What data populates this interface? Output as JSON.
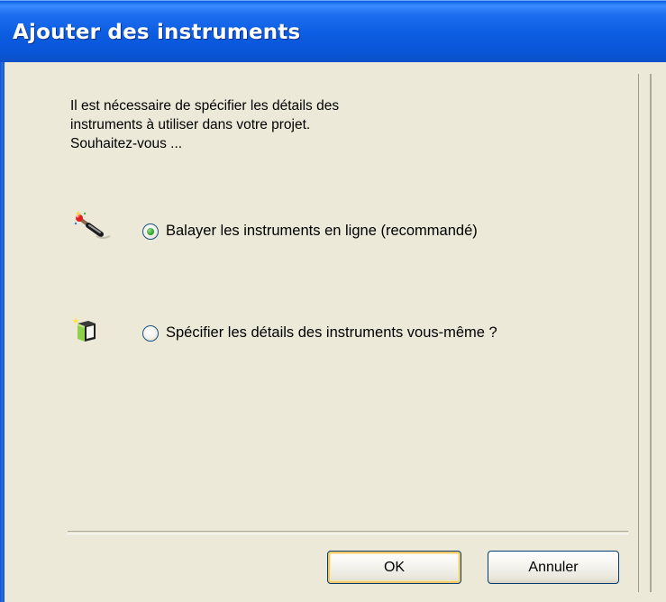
{
  "window": {
    "title": "Ajouter des instruments"
  },
  "intro": {
    "text": "Il est nécessaire de spécifier les détails des\ninstruments à utiliser dans votre projet.\nSouhaitez-vous ..."
  },
  "options": [
    {
      "label": "Balayer les instruments en ligne (recommandé)",
      "selected": true,
      "icon": "scan-wand-icon"
    },
    {
      "label": "Spécifier les détails des instruments vous-même ?",
      "selected": false,
      "icon": "new-box-icon"
    }
  ],
  "buttons": {
    "ok": "OK",
    "cancel": "Annuler"
  },
  "colors": {
    "titlebar": "#0a5fe0",
    "dialog_bg": "#ece9d8",
    "radio_selected": "#31a52b"
  }
}
